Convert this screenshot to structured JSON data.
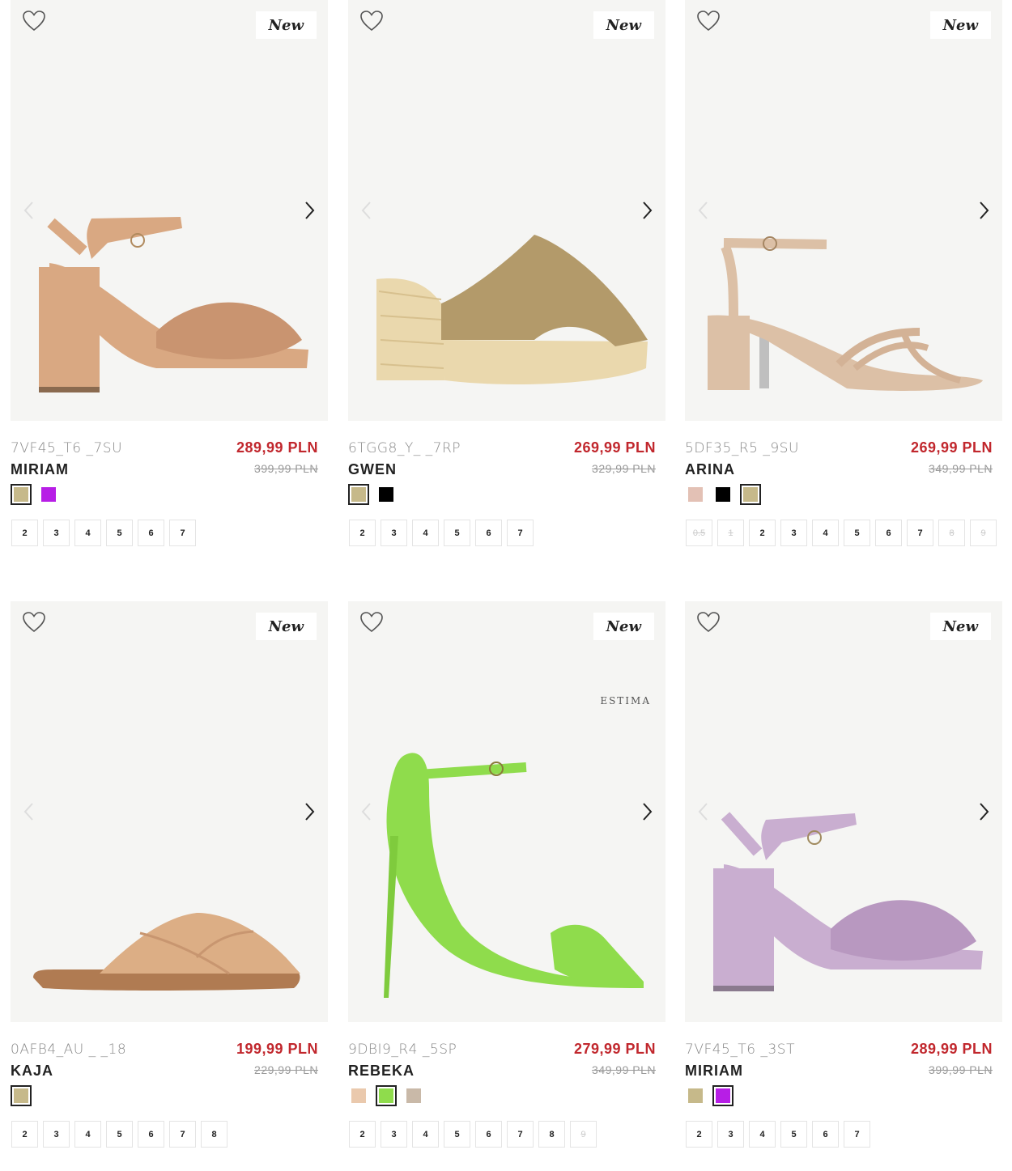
{
  "labels": {
    "new_badge": "New",
    "brand_mark": "ESTIMA"
  },
  "colors": {
    "accent_price": "#c1272d",
    "card_bg": "#f5f5f3"
  },
  "products": [
    {
      "code": "7VF45_T6 _7SU",
      "name": "MIRIAM",
      "price": "289,99 PLN",
      "old_price": "399,99 PLN",
      "shoe": "block-heel-knot-sandal",
      "shoe_color": "#d9a882",
      "swatches": [
        {
          "color": "#c6b98a",
          "selected": true
        },
        {
          "color": "#b71ee6",
          "selected": false
        }
      ],
      "sizes": [
        {
          "label": "2",
          "available": true
        },
        {
          "label": "3",
          "available": true
        },
        {
          "label": "4",
          "available": true
        },
        {
          "label": "5",
          "available": true
        },
        {
          "label": "6",
          "available": true
        },
        {
          "label": "7",
          "available": true
        }
      ]
    },
    {
      "code": "6TGG8_Y_ _7RP",
      "name": "GWEN",
      "price": "269,99 PLN",
      "old_price": "329,99 PLN",
      "shoe": "wooden-clog-mule",
      "shoe_color": "#b39a6a",
      "swatches": [
        {
          "color": "#c6b98a",
          "selected": true
        },
        {
          "color": "#000000",
          "selected": false
        }
      ],
      "sizes": [
        {
          "label": "2",
          "available": true
        },
        {
          "label": "3",
          "available": true
        },
        {
          "label": "4",
          "available": true
        },
        {
          "label": "5",
          "available": true
        },
        {
          "label": "6",
          "available": true
        },
        {
          "label": "7",
          "available": true
        }
      ]
    },
    {
      "code": "5DF35_R5 _9SU",
      "name": "ARINA",
      "price": "269,99 PLN",
      "old_price": "349,99 PLN",
      "shoe": "strappy-block-sandal",
      "shoe_color": "#dcc0a6",
      "swatches": [
        {
          "color": "#e3c1b5",
          "selected": false
        },
        {
          "color": "#000000",
          "selected": false
        },
        {
          "color": "#c6b98a",
          "selected": true
        }
      ],
      "sizes": [
        {
          "label": "0.5",
          "available": false
        },
        {
          "label": "1",
          "available": false
        },
        {
          "label": "2",
          "available": true
        },
        {
          "label": "3",
          "available": true
        },
        {
          "label": "4",
          "available": true
        },
        {
          "label": "5",
          "available": true
        },
        {
          "label": "6",
          "available": true
        },
        {
          "label": "7",
          "available": true
        },
        {
          "label": "8",
          "available": false
        },
        {
          "label": "9",
          "available": false
        }
      ]
    },
    {
      "code": "0AFB4_AU _ _18",
      "name": "KAJA",
      "price": "199,99 PLN",
      "old_price": "229,99 PLN",
      "shoe": "cross-strap-slide",
      "shoe_color": "#dcae85",
      "swatches": [
        {
          "color": "#c6b98a",
          "selected": true
        }
      ],
      "sizes": [
        {
          "label": "2",
          "available": true
        },
        {
          "label": "3",
          "available": true
        },
        {
          "label": "4",
          "available": true
        },
        {
          "label": "5",
          "available": true
        },
        {
          "label": "6",
          "available": true
        },
        {
          "label": "7",
          "available": true
        },
        {
          "label": "8",
          "available": true
        }
      ]
    },
    {
      "code": "9DBI9_R4 _5SP",
      "name": "REBEKA",
      "price": "279,99 PLN",
      "old_price": "349,99 PLN",
      "shoe": "stiletto-sandal",
      "shoe_color": "#8fdc4c",
      "swatches": [
        {
          "color": "#eac9ad",
          "selected": false
        },
        {
          "color": "#8fdc4c",
          "selected": true
        },
        {
          "color": "#c9b9a8",
          "selected": false
        }
      ],
      "sizes": [
        {
          "label": "2",
          "available": true
        },
        {
          "label": "3",
          "available": true
        },
        {
          "label": "4",
          "available": true
        },
        {
          "label": "5",
          "available": true
        },
        {
          "label": "6",
          "available": true
        },
        {
          "label": "7",
          "available": true
        },
        {
          "label": "8",
          "available": true
        },
        {
          "label": "9",
          "available": false
        }
      ]
    },
    {
      "code": "7VF45_T6 _3ST",
      "name": "MIRIAM",
      "price": "289,99 PLN",
      "old_price": "399,99 PLN",
      "shoe": "block-heel-knot-sandal",
      "shoe_color": "#c9aed0",
      "swatches": [
        {
          "color": "#c6b98a",
          "selected": false
        },
        {
          "color": "#b71ee6",
          "selected": true
        }
      ],
      "sizes": [
        {
          "label": "2",
          "available": true
        },
        {
          "label": "3",
          "available": true
        },
        {
          "label": "4",
          "available": true
        },
        {
          "label": "5",
          "available": true
        },
        {
          "label": "6",
          "available": true
        },
        {
          "label": "7",
          "available": true
        }
      ]
    }
  ]
}
